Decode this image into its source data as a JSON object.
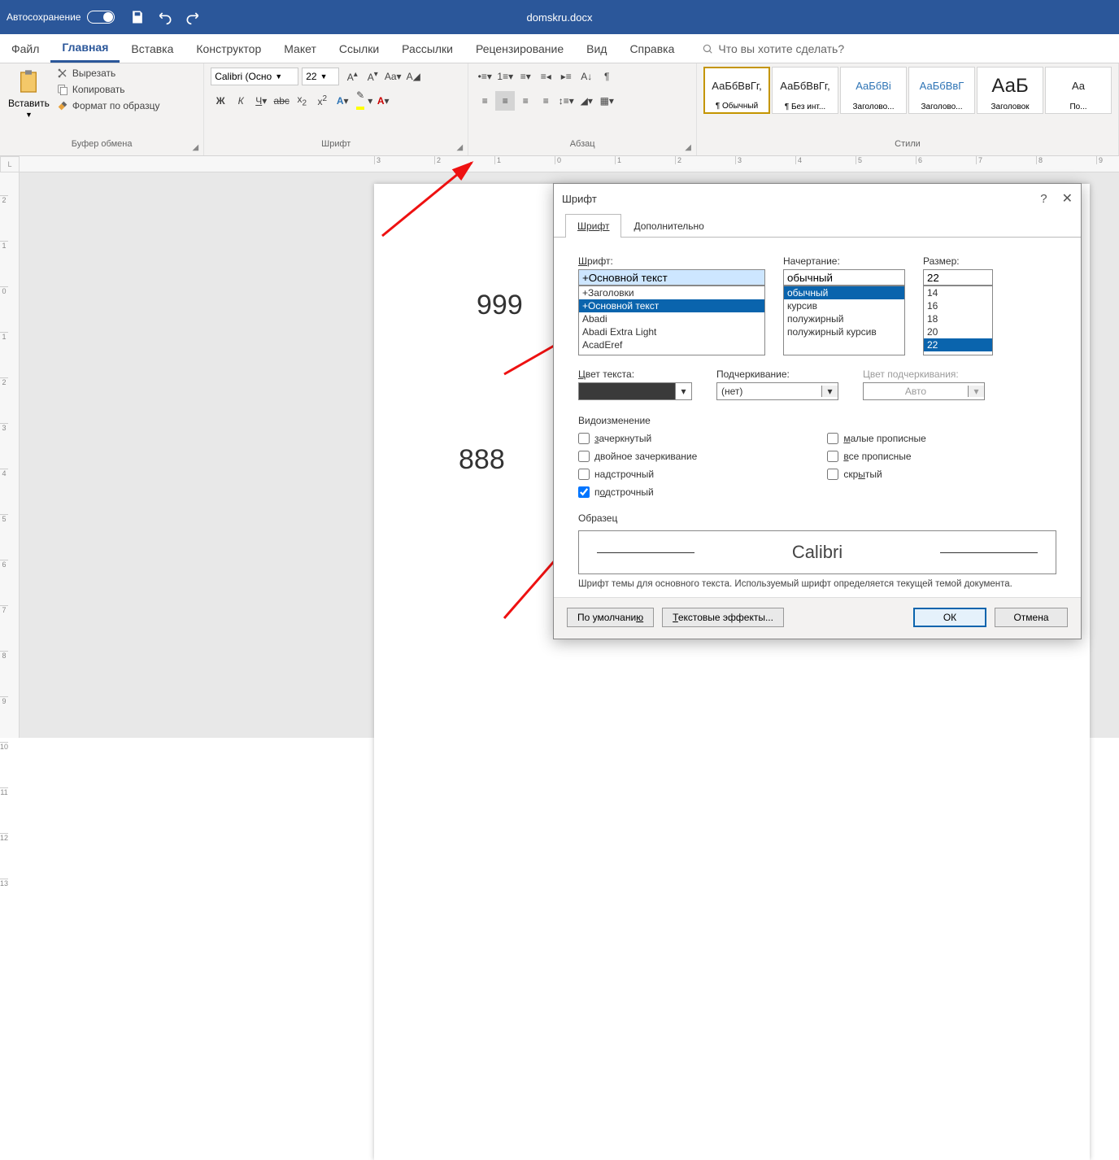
{
  "titlebar": {
    "autosave": "Автосохранение",
    "doc": "domskru.docx"
  },
  "tabs": {
    "file": "Файл",
    "home": "Главная",
    "insert": "Вставка",
    "design": "Конструктор",
    "layout": "Макет",
    "references": "Ссылки",
    "mailings": "Рассылки",
    "review": "Рецензирование",
    "view": "Вид",
    "help": "Справка",
    "tellme": "Что вы хотите сделать?"
  },
  "ribbon": {
    "clipboard": {
      "paste": "Вставить",
      "cut": "Вырезать",
      "copy": "Копировать",
      "painter": "Формат по образцу",
      "label": "Буфер обмена"
    },
    "font": {
      "name": "Calibri (Осно",
      "size": "22",
      "label": "Шрифт"
    },
    "para": {
      "label": "Абзац"
    },
    "styles": {
      "label": "Стили",
      "items": [
        {
          "preview": "АаБбВвГг,",
          "name": "¶ Обычный",
          "sel": true
        },
        {
          "preview": "АаБбВвГг,",
          "name": "¶ Без инт..."
        },
        {
          "preview": "АаБбВі",
          "name": "Заголово...",
          "blue": true
        },
        {
          "preview": "АаБбВвГ",
          "name": "Заголово...",
          "blue": true
        },
        {
          "preview": "АаБ",
          "name": "Заголовок",
          "big": true
        },
        {
          "preview": "Аа",
          "name": "По..."
        }
      ]
    }
  },
  "doc": {
    "t999": "999",
    "t888": "888"
  },
  "dialog": {
    "title": "Шрифт",
    "tab_font": "Шрифт",
    "tab_advanced": "Дополнительно",
    "font_label": "Шрифт:",
    "font_value": "+Основной текст",
    "font_list": [
      "+Заголовки",
      "+Основной текст",
      "Abadi",
      "Abadi Extra Light",
      "AcadEref"
    ],
    "font_list_sel": 1,
    "style_label": "Начертание:",
    "style_value": "обычный",
    "style_list": [
      "обычный",
      "курсив",
      "полужирный",
      "полужирный курсив"
    ],
    "style_list_sel": 0,
    "size_label": "Размер:",
    "size_value": "22",
    "size_list": [
      "14",
      "16",
      "18",
      "20",
      "22"
    ],
    "size_list_sel": 4,
    "color_label": "Цвет текста:",
    "underline_label": "Подчеркивание:",
    "underline_value": "(нет)",
    "ucolor_label": "Цвет подчеркивания:",
    "ucolor_value": "Авто",
    "effects_label": "Видоизменение",
    "effects_left": [
      {
        "label": "зачеркнутый",
        "u": "з"
      },
      {
        "label": "двойное зачеркивание"
      },
      {
        "label": "надстрочный",
        "u": "д"
      },
      {
        "label": "подстрочный",
        "u": "о",
        "checked": true
      }
    ],
    "effects_right": [
      {
        "label": "малые прописные",
        "u": "м"
      },
      {
        "label": "все прописные",
        "u": "в"
      },
      {
        "label": "скрытый",
        "u": "ы"
      }
    ],
    "preview_label": "Образец",
    "preview_text": "Calibri",
    "note": "Шрифт темы для основного текста. Используемый шрифт определяется текущей темой документа.",
    "btn_default": "По умолчанию",
    "btn_effects": "Текстовые эффекты...",
    "btn_ok": "ОК",
    "btn_cancel": "Отмена"
  }
}
